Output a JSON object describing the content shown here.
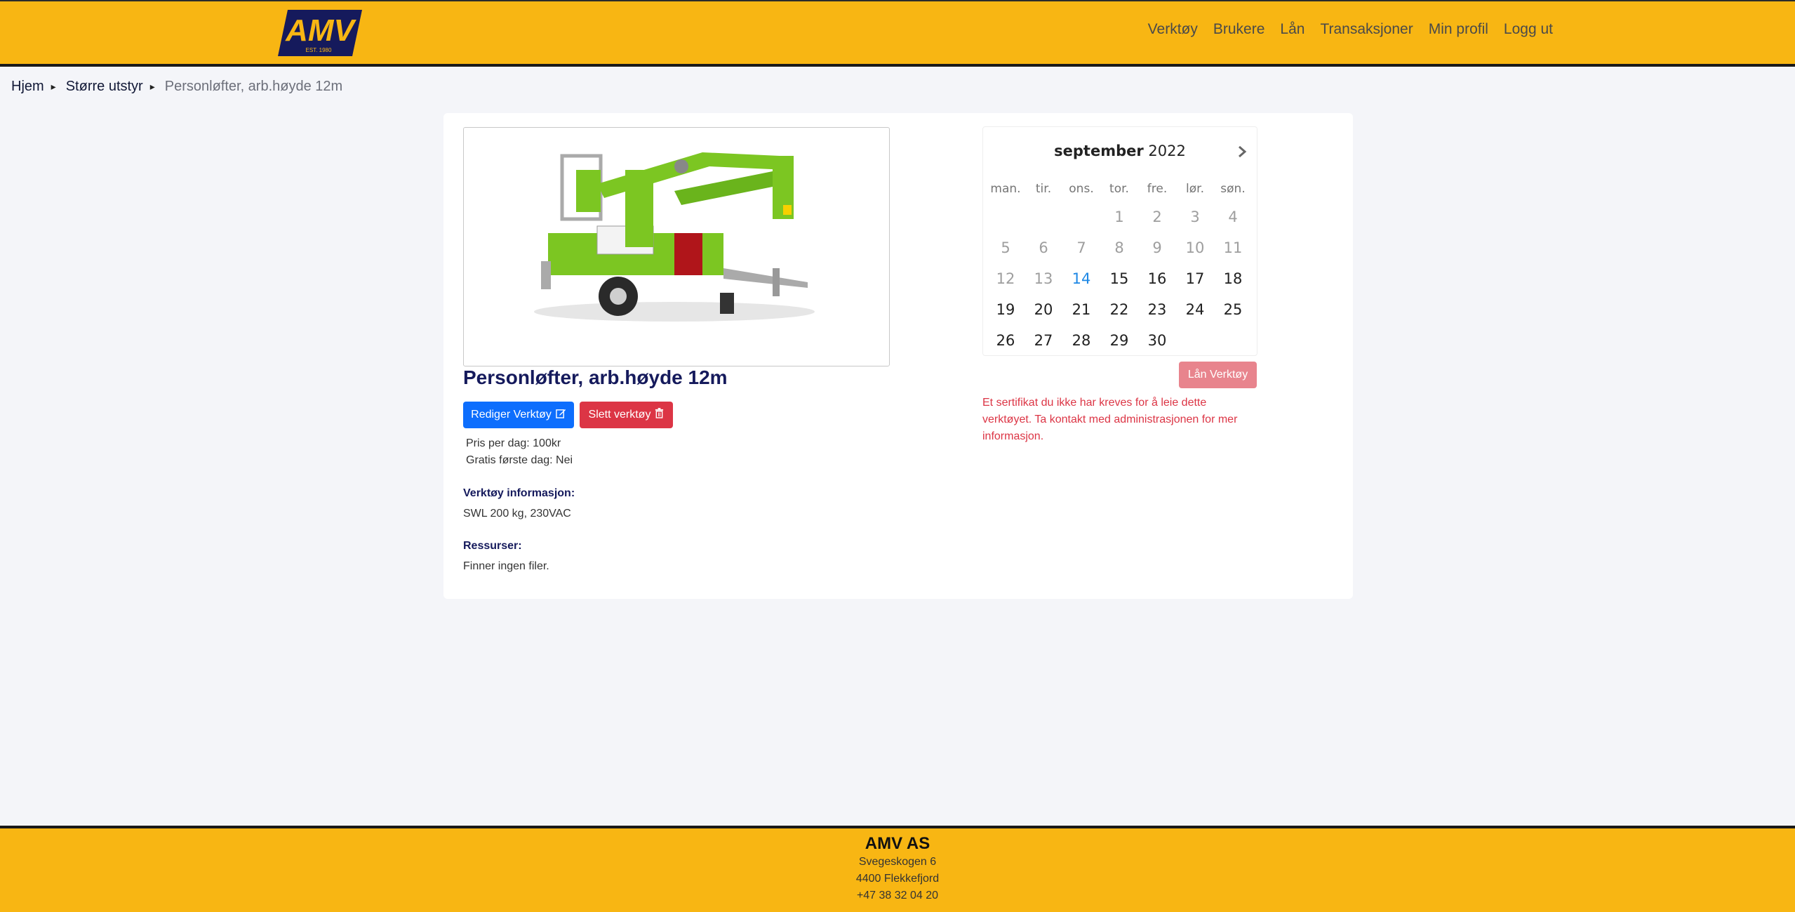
{
  "header": {
    "logo_text": "AMV",
    "logo_subtext": "EST. 1980",
    "nav": [
      "Verktøy",
      "Brukere",
      "Lån",
      "Transaksjoner",
      "Min profil",
      "Logg ut"
    ]
  },
  "breadcrumb": [
    "Hjem",
    "Større utstyr",
    "Personløfter, arb.høyde 12m"
  ],
  "tool": {
    "title": "Personløfter, arb.høyde 12m",
    "edit_label": "Rediger Verktøy",
    "delete_label": "Slett verktøy",
    "price": "Pris per dag: 100kr",
    "free_first_day": "Gratis første dag: Nei",
    "info_label": "Verktøy informasjon:",
    "info_value": "SWL 200 kg, 230VAC",
    "resources_label": "Ressurser:",
    "resources_value": "Finner ingen filer."
  },
  "calendar": {
    "month": "september",
    "year": "2022",
    "weekdays": [
      "man.",
      "tir.",
      "ons.",
      "tor.",
      "fre.",
      "lør.",
      "søn."
    ],
    "lead_blanks": 3,
    "days": [
      1,
      2,
      3,
      4,
      5,
      6,
      7,
      8,
      9,
      10,
      11,
      12,
      13,
      14,
      15,
      16,
      17,
      18,
      19,
      20,
      21,
      22,
      23,
      24,
      25,
      26,
      27,
      28,
      29,
      30
    ],
    "today": 14,
    "loan_label": "Lån Verktøy",
    "warning": "Et sertifikat du ikke har kreves for å leie dette verktøyet. Ta kontakt med administrasjonen for mer informasjon."
  },
  "footer": {
    "company": "AMV AS",
    "address": "Svegeskogen 6",
    "city": "4400 Flekkefjord",
    "phone": "+47 38 32 04 20"
  },
  "colors": {
    "brand_yellow": "#f8b613",
    "primary": "#0d6efd",
    "danger": "#dc3545",
    "title_navy": "#151a5c"
  }
}
